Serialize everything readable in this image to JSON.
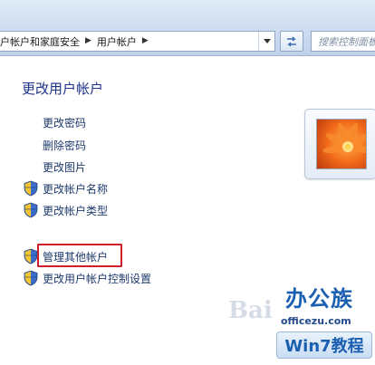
{
  "address_bar": {
    "breadcrumbs": [
      {
        "label": "户帐户和家庭安全"
      },
      {
        "label": "用户帐户"
      }
    ],
    "search_placeholder": "搜索控制面板"
  },
  "main": {
    "heading": "更改用户帐户",
    "tasks": [
      {
        "label": "更改密码",
        "icon": "none"
      },
      {
        "label": "删除密码",
        "icon": "none"
      },
      {
        "label": "更改图片",
        "icon": "none"
      },
      {
        "label": "更改帐户名称",
        "icon": "uac-shield-icon"
      },
      {
        "label": "更改帐户类型",
        "icon": "uac-shield-icon"
      }
    ],
    "other_tasks": [
      {
        "label": "管理其他帐户",
        "icon": "uac-shield-icon",
        "highlighted": true
      },
      {
        "label": "更改用户帐户控制设置",
        "icon": "uac-shield-icon"
      }
    ]
  },
  "watermark": {
    "top_text": "办公族",
    "site_text": "officezu.com",
    "bottom_text": "Win7教程",
    "overlay_text": "Bai"
  },
  "colors": {
    "heading": "#1e3287",
    "link": "#1e3a6c",
    "highlight_box": "#d21e2a",
    "watermark": "#1b5fb1"
  }
}
